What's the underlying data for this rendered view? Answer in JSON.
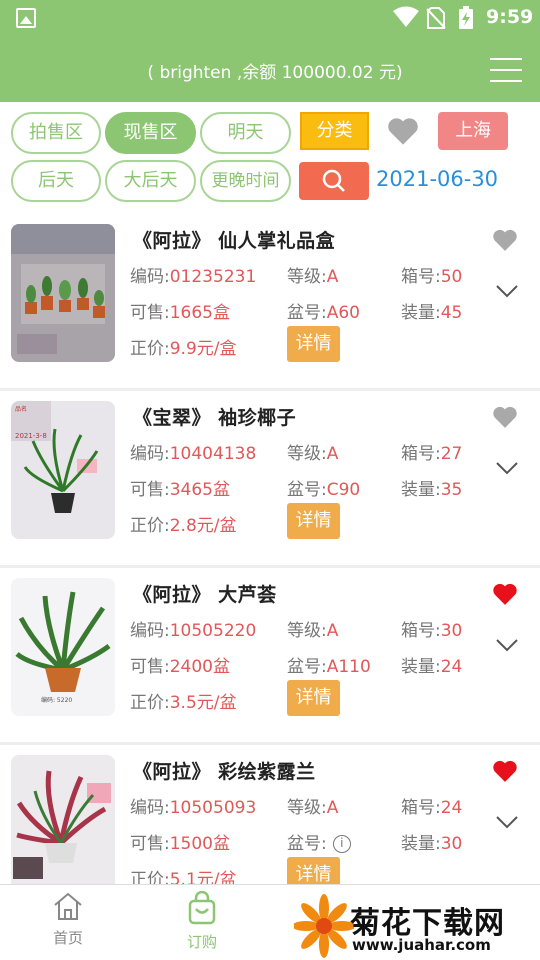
{
  "status": {
    "time": "9:59"
  },
  "header": {
    "title": "( brighten ,余额 100000.02 元)"
  },
  "filters": {
    "tabs": [
      "拍售区",
      "现售区",
      "明天",
      "后天",
      "大后天",
      "更晚时间"
    ],
    "active_tab": "现售区",
    "category_label": "分类",
    "city_label": "上海",
    "date": "2021-06-30",
    "colors": {
      "green": "#8cc673",
      "yellow": "#fbbc10",
      "red": "#f08686",
      "blue": "#2a8fd8"
    }
  },
  "labels": {
    "code": "编码:",
    "grade": "等级:",
    "box": "箱号:",
    "available": "可售:",
    "pot": "盆号:",
    "pack": "装量:",
    "price": "正价:",
    "detail": "详情"
  },
  "products": [
    {
      "name": "《阿拉》 仙人掌礼品盒",
      "code": "01235231",
      "grade": "A",
      "box": "50",
      "available": "1665盒",
      "pot": "A60",
      "pack": "45",
      "price": "9.9元/盒",
      "favorited": false
    },
    {
      "name": "《宝翠》 袖珍椰子",
      "code": "10404138",
      "grade": "A",
      "box": "27",
      "available": "3465盆",
      "pot": "C90",
      "pack": "35",
      "price": "2.8元/盆",
      "favorited": false
    },
    {
      "name": "《阿拉》 大芦荟",
      "code": "10505220",
      "grade": "A",
      "box": "30",
      "available": "2400盆",
      "pot": "A110",
      "pack": "24",
      "price": "3.5元/盆",
      "favorited": true
    },
    {
      "name": "《阿拉》 彩绘紫露兰",
      "code": "10505093",
      "grade": "A",
      "box": "24",
      "available": "1500盆",
      "pot": "",
      "pack": "30",
      "price": "5.1元/盆",
      "favorited": true
    }
  ],
  "nav": {
    "home": "首页",
    "order": "订购"
  },
  "watermark": {
    "brand": "菊花下载网",
    "url": "www.juahar.com"
  }
}
